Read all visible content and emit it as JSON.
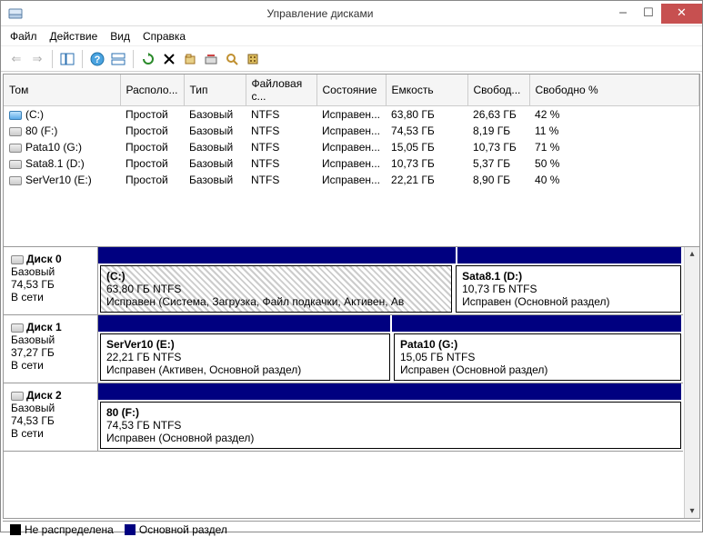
{
  "window": {
    "title": "Управление дисками"
  },
  "menu": {
    "file": "Файл",
    "action": "Действие",
    "view": "Вид",
    "help": "Справка"
  },
  "columns": {
    "volume": "Том",
    "layout": "Располо...",
    "type": "Тип",
    "fs": "Файловая с...",
    "status": "Состояние",
    "capacity": "Емкость",
    "free": "Свобод...",
    "freepct": "Свободно %"
  },
  "volumes": [
    {
      "name": "(C:)",
      "icon": "c",
      "layout": "Простой",
      "type": "Базовый",
      "fs": "NTFS",
      "status": "Исправен...",
      "capacity": "63,80 ГБ",
      "free": "26,63 ГБ",
      "freepct": "42 %"
    },
    {
      "name": "80 (F:)",
      "icon": "",
      "layout": "Простой",
      "type": "Базовый",
      "fs": "NTFS",
      "status": "Исправен...",
      "capacity": "74,53 ГБ",
      "free": "8,19 ГБ",
      "freepct": "11 %"
    },
    {
      "name": "Pata10 (G:)",
      "icon": "",
      "layout": "Простой",
      "type": "Базовый",
      "fs": "NTFS",
      "status": "Исправен...",
      "capacity": "15,05 ГБ",
      "free": "10,73 ГБ",
      "freepct": "71 %"
    },
    {
      "name": "Sata8.1 (D:)",
      "icon": "",
      "layout": "Простой",
      "type": "Базовый",
      "fs": "NTFS",
      "status": "Исправен...",
      "capacity": "10,73 ГБ",
      "free": "5,37 ГБ",
      "freepct": "50 %"
    },
    {
      "name": "SerVer10 (E:)",
      "icon": "",
      "layout": "Простой",
      "type": "Базовый",
      "fs": "NTFS",
      "status": "Исправен...",
      "capacity": "22,21 ГБ",
      "free": "8,90 ГБ",
      "freepct": "40 %"
    }
  ],
  "disks": [
    {
      "label": "Диск 0",
      "type": "Базовый",
      "size": "74,53 ГБ",
      "status": "В сети",
      "partitions": [
        {
          "title": "(C:)",
          "size": "63,80 ГБ NTFS",
          "status": "Исправен (Система, Загрузка, Файл подкачки, Активен, Ав",
          "hatched": true,
          "flex": 63.8
        },
        {
          "title": "Sata8.1  (D:)",
          "size": "10,73 ГБ NTFS",
          "status": "Исправен (Основной раздел)",
          "hatched": false,
          "flex": 40
        }
      ]
    },
    {
      "label": "Диск 1",
      "type": "Базовый",
      "size": "37,27 ГБ",
      "status": "В сети",
      "partitions": [
        {
          "title": "SerVer10  (E:)",
          "size": "22,21 ГБ NTFS",
          "status": "Исправен (Активен, Основной раздел)",
          "hatched": false,
          "flex": 22.21
        },
        {
          "title": "Pata10  (G:)",
          "size": "15,05 ГБ NTFS",
          "status": "Исправен (Основной раздел)",
          "hatched": false,
          "flex": 22
        }
      ]
    },
    {
      "label": "Диск 2",
      "type": "Базовый",
      "size": "74,53 ГБ",
      "status": "В сети",
      "partitions": [
        {
          "title": "80  (F:)",
          "size": "74,53 ГБ NTFS",
          "status": "Исправен (Основной раздел)",
          "hatched": false,
          "flex": 1
        }
      ]
    }
  ],
  "legend": {
    "unallocated": "Не распределена",
    "primary": "Основной раздел"
  }
}
